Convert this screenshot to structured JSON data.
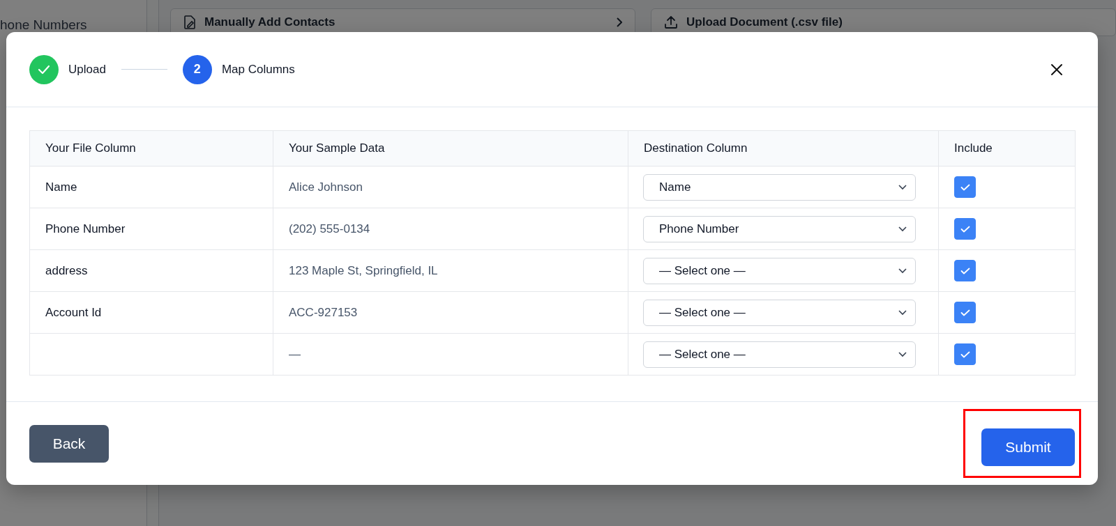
{
  "background": {
    "sidebar_items": [
      {
        "label": "hone Numbers"
      }
    ],
    "cards": [
      {
        "title": "Manually Add Contacts"
      },
      {
        "title": "Upload Document (.csv file)"
      }
    ]
  },
  "modal": {
    "steps": [
      {
        "label": "Upload",
        "kind": "done"
      },
      {
        "label": "Map Columns",
        "kind": "current",
        "number": "2"
      }
    ],
    "table": {
      "columns": [
        "Your File Column",
        "Your Sample Data",
        "Destination Column",
        "Include"
      ],
      "rows": [
        {
          "file_column": "Name",
          "sample": "Alice Johnson",
          "destination": "Name",
          "include": true
        },
        {
          "file_column": "Phone Number",
          "sample": "(202) 555-0134",
          "destination": "Phone Number",
          "include": true
        },
        {
          "file_column": "address",
          "sample": "123 Maple St, Springfield, IL",
          "destination": "— Select one —",
          "include": true
        },
        {
          "file_column": "Account Id",
          "sample": "ACC-927153",
          "destination": "— Select one —",
          "include": true
        },
        {
          "sample": "—",
          "destination": "— Select one —",
          "include": true
        }
      ]
    },
    "buttons": [
      {
        "label": "Back",
        "kind": "secondary",
        "highlighted": false
      },
      {
        "label": "Submit",
        "kind": "primary",
        "highlighted": true
      }
    ]
  }
}
